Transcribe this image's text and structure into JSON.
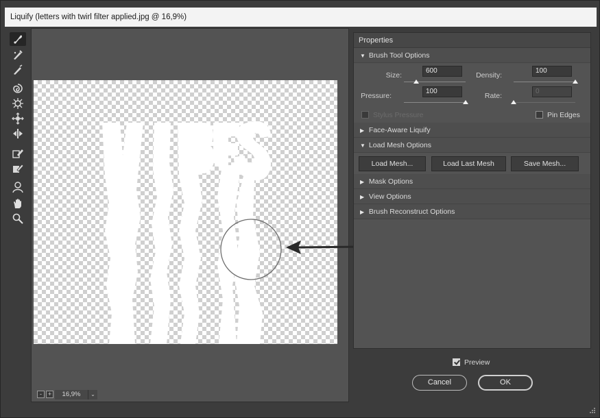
{
  "window": {
    "title": "Liquify (letters with twirl filter applied.jpg @ 16,9%)"
  },
  "toolbar": {
    "tools": [
      {
        "icon": "forward-warp-icon"
      },
      {
        "icon": "reconstruct-icon"
      },
      {
        "icon": "smooth-icon"
      },
      {
        "icon": "twirl-clockwise-icon"
      },
      {
        "icon": "pucker-icon"
      },
      {
        "icon": "bloat-icon"
      },
      {
        "icon": "push-left-icon"
      },
      {
        "icon": "freeze-mask-icon"
      },
      {
        "icon": "thaw-mask-icon"
      },
      {
        "icon": "face-tool-icon"
      },
      {
        "icon": "hand-icon"
      },
      {
        "icon": "zoom-icon"
      }
    ]
  },
  "canvas": {
    "artwork_text": "VIBES",
    "zoom": "16,9%",
    "zoom_out_label": "-",
    "zoom_in_label": "+",
    "zoom_dropdown_label": "⌄"
  },
  "properties": {
    "header": "Properties",
    "brush_tool_options": {
      "title": "Brush Tool Options",
      "size_label": "Size:",
      "size_value": "600",
      "density_label": "Density:",
      "density_value": "100",
      "pressure_label": "Pressure:",
      "pressure_value": "100",
      "rate_label": "Rate:",
      "rate_value": "0",
      "stylus_pressure_label": "Stylus Pressure",
      "pin_edges_label": "Pin Edges"
    },
    "face_aware": {
      "title": "Face-Aware Liquify"
    },
    "load_mesh": {
      "title": "Load Mesh Options",
      "load_mesh_label": "Load Mesh...",
      "load_last_mesh_label": "Load Last Mesh",
      "save_mesh_label": "Save Mesh..."
    },
    "mask_options": {
      "title": "Mask Options"
    },
    "view_options": {
      "title": "View Options"
    },
    "brush_reconstruct": {
      "title": "Brush Reconstruct Options"
    }
  },
  "footer": {
    "preview_label": "Preview",
    "cancel_label": "Cancel",
    "ok_label": "OK"
  },
  "levels": {
    "size": 0.2,
    "density": 1.0,
    "pressure": 1.0,
    "rate": 0.0
  },
  "colors": {
    "window_bg": "#3c3c3c",
    "panel_bg": "#535353",
    "accent_text": "#d6d6d6"
  }
}
